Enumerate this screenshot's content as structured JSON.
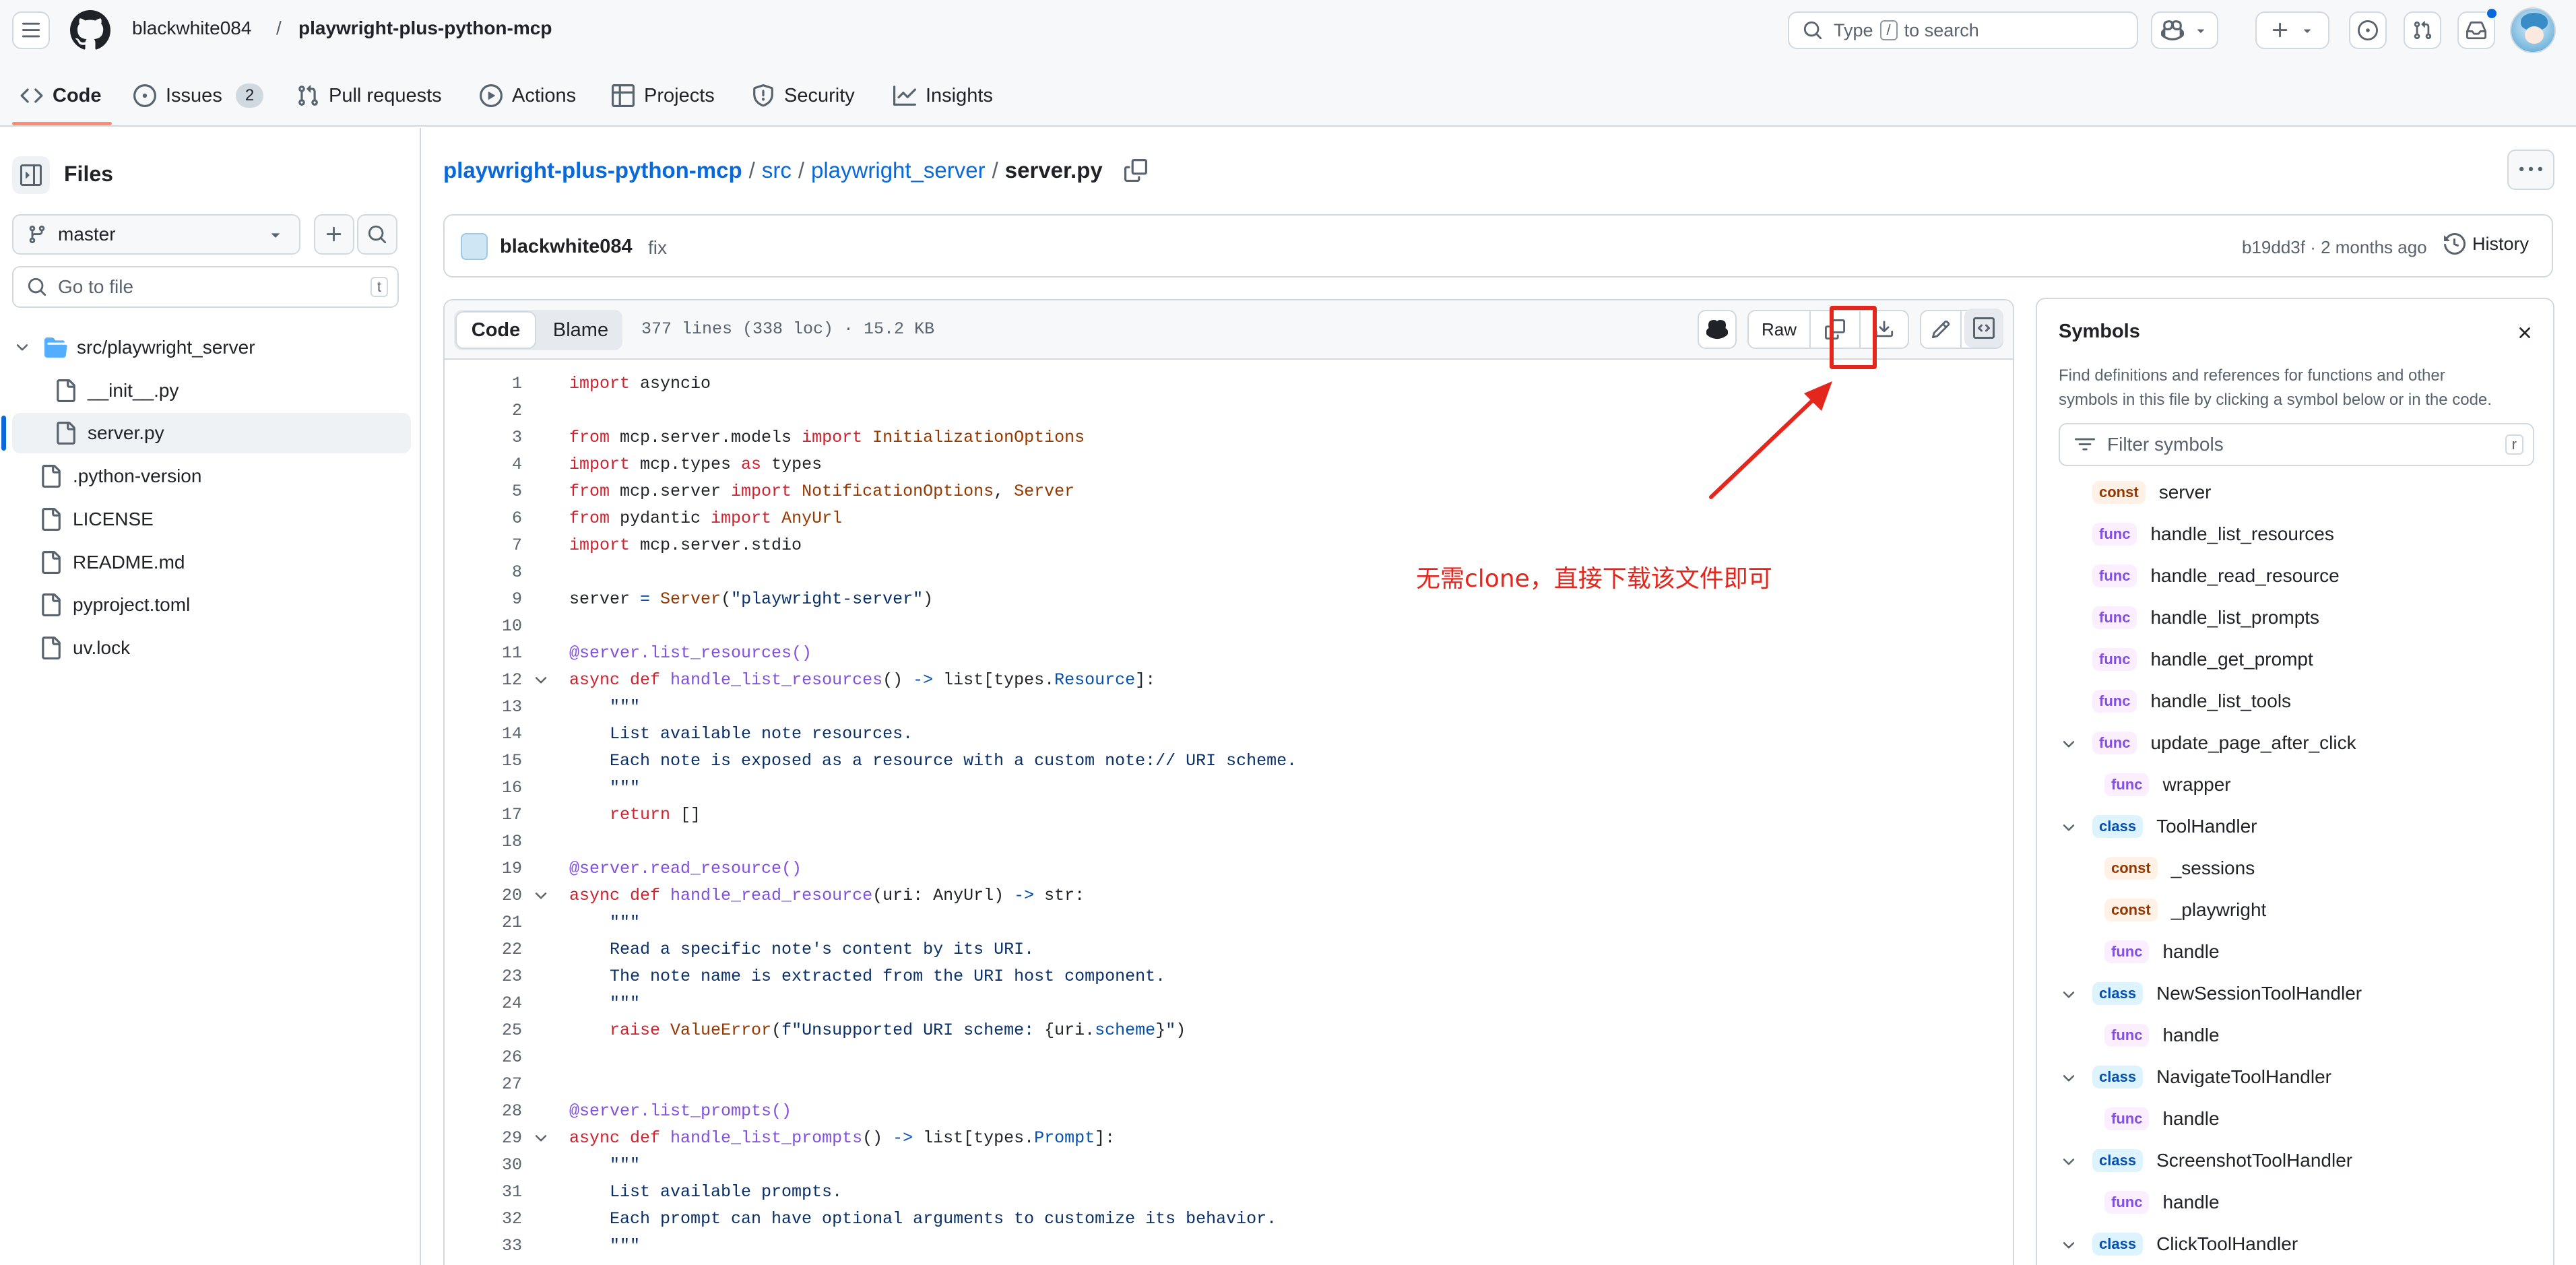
{
  "header": {
    "owner": "blackwhite084",
    "separator": "/",
    "repo": "playwright-plus-python-mcp",
    "search_prefix": "Type",
    "search_key": "/",
    "search_suffix": "to search"
  },
  "tabs": [
    {
      "label": "Code"
    },
    {
      "label": "Issues",
      "count": "2"
    },
    {
      "label": "Pull requests"
    },
    {
      "label": "Actions"
    },
    {
      "label": "Projects"
    },
    {
      "label": "Security"
    },
    {
      "label": "Insights"
    }
  ],
  "sidebar": {
    "title": "Files",
    "branch": "master",
    "goto_placeholder": "Go to file",
    "goto_shortcut": "t",
    "tree": [
      {
        "label": "src/playwright_server"
      },
      {
        "label": "__init__.py"
      },
      {
        "label": "server.py"
      },
      {
        "label": ".python-version"
      },
      {
        "label": "LICENSE"
      },
      {
        "label": "README.md"
      },
      {
        "label": "pyproject.toml"
      },
      {
        "label": "uv.lock"
      }
    ]
  },
  "breadcrumb": {
    "repo": "playwright-plus-python-mcp",
    "sep": "/",
    "dir1": "src",
    "dir2": "playwright_server",
    "file": "server.py"
  },
  "commit": {
    "author": "blackwhite084",
    "message": "fix",
    "sha_time": "b19dd3f · 2 months ago",
    "history": "History"
  },
  "file_toolbar": {
    "code": "Code",
    "blame": "Blame",
    "meta": "377 lines (338 loc) · 15.2 KB",
    "raw": "Raw"
  },
  "annotation": {
    "text": "无需clone，直接下载该文件即可",
    "color": "#e5261c"
  },
  "code_lines": [
    {
      "n": "1"
    },
    {
      "n": "2"
    },
    {
      "n": "3"
    },
    {
      "n": "4"
    },
    {
      "n": "5"
    },
    {
      "n": "6"
    },
    {
      "n": "7"
    },
    {
      "n": "8"
    },
    {
      "n": "9"
    },
    {
      "n": "10"
    },
    {
      "n": "11"
    },
    {
      "n": "12"
    },
    {
      "n": "13"
    },
    {
      "n": "14"
    },
    {
      "n": "15"
    },
    {
      "n": "16"
    },
    {
      "n": "17"
    },
    {
      "n": "18"
    },
    {
      "n": "19"
    },
    {
      "n": "20"
    },
    {
      "n": "21"
    },
    {
      "n": "22"
    },
    {
      "n": "23"
    },
    {
      "n": "24"
    },
    {
      "n": "25"
    },
    {
      "n": "26"
    },
    {
      "n": "27"
    },
    {
      "n": "28"
    },
    {
      "n": "29"
    },
    {
      "n": "30"
    },
    {
      "n": "31"
    },
    {
      "n": "32"
    },
    {
      "n": "33"
    }
  ],
  "code_text": {
    "l1a": "import",
    "l1b": " asyncio",
    "l3a": "from",
    "l3b": " mcp.server.models ",
    "l3c": "import",
    "l3d": " InitializationOptions",
    "l4a": "import",
    "l4b": " mcp.types ",
    "l4c": "as",
    "l4d": " types",
    "l5a": "from",
    "l5b": " mcp.server ",
    "l5c": "import",
    "l5d": " NotificationOptions",
    "l5e": ", ",
    "l5f": "Server",
    "l6a": "from",
    "l6b": " pydantic ",
    "l6c": "import",
    "l6d": " AnyUrl",
    "l7a": "import",
    "l7b": " mcp.server.stdio",
    "l9a": "server ",
    "l9b": "=",
    "l9c": " Server",
    "l9d": "(",
    "l9e": "\"playwright-server\"",
    "l9f": ")",
    "l11a": "@server.list_resources()",
    "l12a": "async",
    "l12b": " def",
    "l12c": " handle_list_resources",
    "l12d": "() ",
    "l12e": "->",
    "l12f": " list[types.",
    "l12g": "Resource",
    "l12h": "]:",
    "l13a": "    \"\"\"",
    "l14a": "    List available note resources.",
    "l15a": "    Each note is exposed as a resource with a custom note:// URI scheme.",
    "l16a": "    \"\"\"",
    "l17a": "    return",
    "l17b": " []",
    "l19a": "@server.read_resource()",
    "l20a": "async",
    "l20b": " def",
    "l20c": " handle_read_resource",
    "l20d": "(uri: AnyUrl) ",
    "l20e": "->",
    "l20f": " str:",
    "l21a": "    \"\"\"",
    "l22a": "    Read a specific note's content by its URI.",
    "l23a": "    The note name is extracted from the URI host component.",
    "l24a": "    \"\"\"",
    "l25a": "    raise",
    "l25b": " ValueError",
    "l25c": "(",
    "l25d": "f\"Unsupported URI scheme: ",
    "l25e": "{uri.",
    "l25f": "scheme",
    "l25g": "}",
    "l25h": "\"",
    "l25i": ")",
    "l28a": "@server.list_prompts()",
    "l29a": "async",
    "l29b": " def",
    "l29c": " handle_list_prompts",
    "l29d": "() ",
    "l29e": "->",
    "l29f": " list[types.",
    "l29g": "Prompt",
    "l29h": "]:",
    "l30a": "    \"\"\"",
    "l31a": "    List available prompts.",
    "l32a": "    Each prompt can have optional arguments to customize its behavior.",
    "l33a": "    \"\"\""
  },
  "symbols": {
    "title": "Symbols",
    "description_1": "Find definitions and references for functions and other",
    "description_2": "symbols in this file by clicking a symbol below or in the code.",
    "filter_placeholder": "Filter symbols",
    "filter_shortcut": "r",
    "items": [
      {
        "kind": "const",
        "name": "server"
      },
      {
        "kind": "func",
        "name": "handle_list_resources"
      },
      {
        "kind": "func",
        "name": "handle_read_resource"
      },
      {
        "kind": "func",
        "name": "handle_list_prompts"
      },
      {
        "kind": "func",
        "name": "handle_get_prompt"
      },
      {
        "kind": "func",
        "name": "handle_list_tools"
      },
      {
        "kind": "func",
        "name": "update_page_after_click"
      },
      {
        "kind": "func",
        "name": "wrapper"
      },
      {
        "kind": "class",
        "name": "ToolHandler"
      },
      {
        "kind": "const",
        "name": "_sessions"
      },
      {
        "kind": "const",
        "name": "_playwright"
      },
      {
        "kind": "func",
        "name": "handle"
      },
      {
        "kind": "class",
        "name": "NewSessionToolHandler"
      },
      {
        "kind": "func",
        "name": "handle"
      },
      {
        "kind": "class",
        "name": "NavigateToolHandler"
      },
      {
        "kind": "func",
        "name": "handle"
      },
      {
        "kind": "class",
        "name": "ScreenshotToolHandler"
      },
      {
        "kind": "func",
        "name": "handle"
      },
      {
        "kind": "class",
        "name": "ClickToolHandler"
      }
    ]
  },
  "colors": {
    "link": "#0969da",
    "accent_underline": "#fd8c73",
    "selected_bar": "#0969da"
  }
}
